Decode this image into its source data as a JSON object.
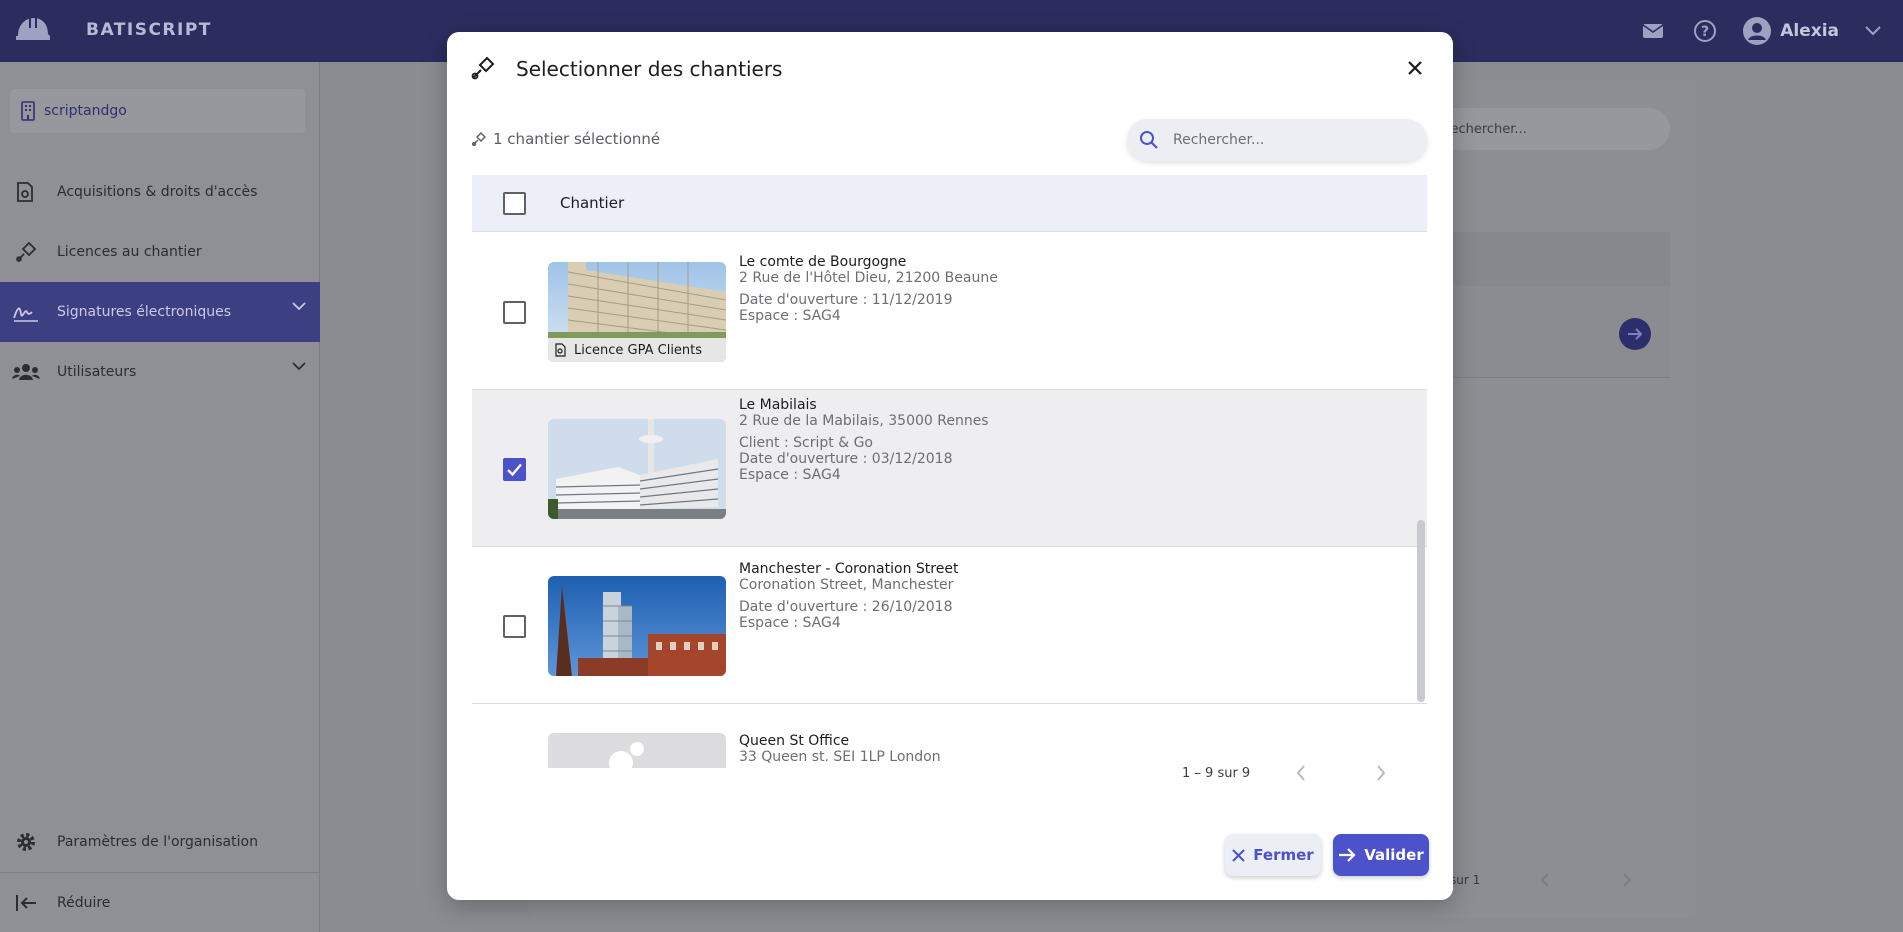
{
  "app": {
    "brand": "BATISCRIPT",
    "user_name": "Alexia"
  },
  "sidebar": {
    "organization": "scriptandgo",
    "items": [
      {
        "label": "Acquisitions & droits d'accès"
      },
      {
        "label": "Licences au chantier"
      },
      {
        "label": "Signatures électroniques"
      },
      {
        "label": "Utilisateurs"
      }
    ],
    "settings_label": "Paramètres de l'organisation",
    "collapse_label": "Réduire"
  },
  "background": {
    "search_placeholder": "Rechercher...",
    "pagination": "sur 1"
  },
  "modal": {
    "title": "Selectionner des chantiers",
    "selected_count": "1 chantier sélectionné",
    "search_placeholder": "Rechercher...",
    "column_header": "Chantier",
    "rows": [
      {
        "name": "Le comte de Bourgogne",
        "address": "2 Rue de l'Hôtel Dieu, 21200 Beaune",
        "opening": "Date d'ouverture : 11/12/2019",
        "space": "Espace : SAG4",
        "license_badge": "Licence GPA Clients",
        "checked": false
      },
      {
        "name": "Le Mabilais",
        "address": "2 Rue de la Mabilais, 35000 Rennes",
        "client": "Client : Script & Go",
        "opening": "Date d'ouverture : 03/12/2018",
        "space": "Espace : SAG4",
        "checked": true
      },
      {
        "name": "Manchester - Coronation Street",
        "address": "Coronation Street, Manchester",
        "opening": "Date d'ouverture : 26/10/2018",
        "space": "Espace : SAG4",
        "checked": false
      },
      {
        "name": "Queen St Office",
        "address": "33 Queen st. SEI 1LP London",
        "checked": false
      }
    ],
    "pagination": "1 – 9 sur 9",
    "close_button": "Fermer",
    "validate_button": "Valider"
  },
  "colors": {
    "accent": "#4c52c9",
    "topbar": "#2a2d5e",
    "sidebar_active": "#3c3f82"
  }
}
